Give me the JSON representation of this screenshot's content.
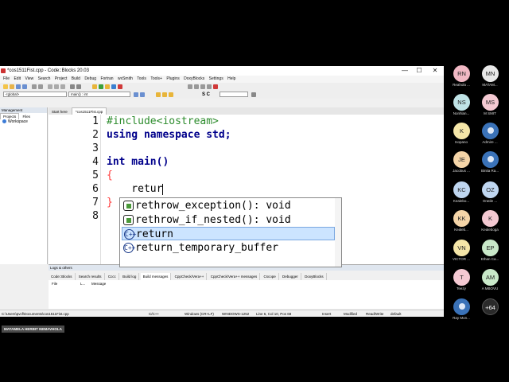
{
  "window": {
    "title": "*cos1511Fist.cpp - Code::Blocks 20.03",
    "minimize": "—",
    "maximize": "☐",
    "close": "✕"
  },
  "menu": [
    "File",
    "Edit",
    "View",
    "Search",
    "Project",
    "Build",
    "Debug",
    "Fortran",
    "wxSmith",
    "Tools",
    "Tools+",
    "Plugins",
    "DoxyBlocks",
    "Settings",
    "Help"
  ],
  "toolbar": {
    "scope_combo": "<global>",
    "symbol_combo": "main() : int",
    "sc_text": "S C"
  },
  "management": {
    "title": "Management",
    "tabs": [
      "Projects",
      "Files"
    ],
    "workspace": "Workspace"
  },
  "editor_tabs": [
    "Start here",
    "*cos1511Fist.cpp"
  ],
  "code_lines": [
    {
      "n": "1",
      "text": "#include<iostream>"
    },
    {
      "n": "2",
      "text": "using namespace std;"
    },
    {
      "n": "3",
      "text": ""
    },
    {
      "n": "4",
      "text": "int main()"
    },
    {
      "n": "5",
      "text": "{"
    },
    {
      "n": "6",
      "text": "    retur"
    },
    {
      "n": "7",
      "text": "}"
    },
    {
      "n": "8",
      "text": ""
    }
  ],
  "autocomplete": [
    "rethrow_exception(): void",
    "rethrow_if_nested(): void",
    "return",
    "return_temporary_buffer"
  ],
  "logs": {
    "title": "Logs & others",
    "tabs": [
      "Code::Blocks",
      "Search results",
      "Cccc",
      "Build log",
      "Build messages",
      "CppCheck/Vera++",
      "CppCheck/Vera++ messages",
      "Cscope",
      "Debugger",
      "DoxyBlocks"
    ],
    "col_file": "File",
    "col_line": "L...",
    "col_message": "Message"
  },
  "status": {
    "path": "C:\\Users\\pvcf\\Documents\\cos1511Fist.cpp",
    "lang": "C/C++",
    "eol": "Windows (CR+LF)",
    "encoding": "WINDOWS-1252",
    "pos": "Line 6, Col 10, Pos 68",
    "mode": "Insert",
    "modified": "Modified",
    "rw": "Read/Write",
    "profile": "default"
  },
  "name_tag": "MATAMELA HERBIT NEMAVHOLA",
  "participants": [
    {
      "initials": "RN",
      "name": "Reahola ...",
      "color": "#f1b8c4"
    },
    {
      "initials": "MN",
      "name": "MATAM...",
      "color": "#e8e8e8"
    },
    {
      "initials": "NS",
      "name": "Nonhlan...",
      "color": "#bfe3e6"
    },
    {
      "initials": "MS",
      "name": "M SMIT",
      "color": "#f4c9d2"
    },
    {
      "initials": "K",
      "name": "Isopano",
      "color": "#f5e6a8"
    },
    {
      "initials": "",
      "name": "Admire ...",
      "color": "#3a72b8"
    },
    {
      "initials": "JE",
      "name": "Jacobus ...",
      "color": "#f5d5a8"
    },
    {
      "initials": "",
      "name": "Binita Ra...",
      "color": "#3a72b8"
    },
    {
      "initials": "KC",
      "name": "Kealebo...",
      "color": "#bfd6f0"
    },
    {
      "initials": "OZ",
      "name": "Oratile ...",
      "color": "#bfd6f0"
    },
    {
      "initials": "KK",
      "name": "Kealeb...",
      "color": "#f5d5a8"
    },
    {
      "initials": "K",
      "name": "Kealeboga",
      "color": "#f4c9d2"
    },
    {
      "initials": "VN",
      "name": "VICTOR ...",
      "color": "#f5e6a8"
    },
    {
      "initials": "EP",
      "name": "Ethan Ca...",
      "color": "#c9e8c9"
    },
    {
      "initials": "T",
      "name": "Teezy",
      "color": "#f4c9d2"
    },
    {
      "initials": "AM",
      "name": "A MBOVU",
      "color": "#c9e8c9"
    },
    {
      "initials": "",
      "name": "Ray Mon...",
      "color": "#3a72b8"
    },
    {
      "initials": "+64",
      "name": "",
      "color": "#2a2a2a"
    }
  ]
}
